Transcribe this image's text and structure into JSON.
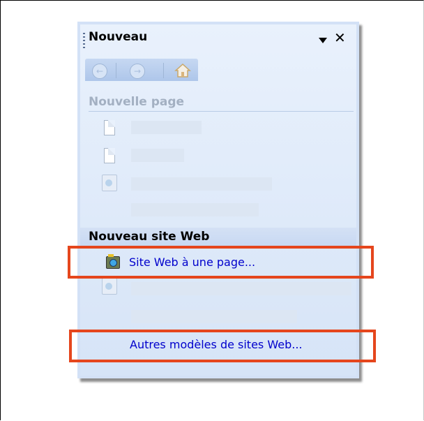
{
  "panel": {
    "title": "Nouveau",
    "menu_icon": "dropdown-arrow-icon",
    "close_glyph": "✕",
    "toolbar": {
      "back_icon": "back-arrow-icon",
      "back_glyph": "←",
      "forward_icon": "forward-arrow-icon",
      "forward_glyph": "→",
      "home_icon": "home-icon"
    }
  },
  "sections": {
    "new_page": {
      "title": "Nouvelle page"
    },
    "new_site": {
      "title": "Nouveau site Web",
      "one_page_site_link": "Site Web à une page...",
      "more_templates_link": "Autres modèles de sites Web..."
    }
  },
  "colors": {
    "highlight_border": "#e5461d",
    "link": "#0000cc",
    "disabled_text": "#a3b0c2"
  }
}
